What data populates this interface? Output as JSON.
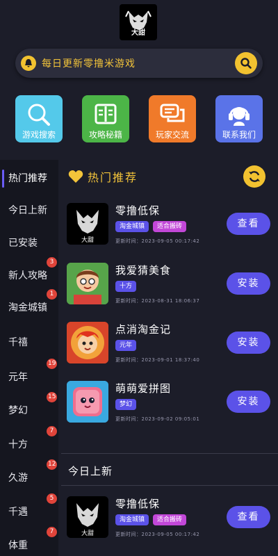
{
  "logo": {
    "text": "大甜"
  },
  "search": {
    "placeholder": "每日更新零撸米游戏",
    "icon": "search-icon",
    "accent": "#f2c230"
  },
  "quick_actions": [
    {
      "label": "游戏搜索",
      "icon": "magnifier-icon",
      "color": "#54c9ea"
    },
    {
      "label": "攻略秘籍",
      "icon": "book-icon",
      "color": "#4cb547"
    },
    {
      "label": "玩家交流",
      "icon": "chat-icon",
      "color": "#f07a2a"
    },
    {
      "label": "联系我们",
      "icon": "headset-icon",
      "color": "#5a73e8"
    }
  ],
  "sidebar": {
    "items": [
      {
        "label": "热门推荐",
        "badge": ""
      },
      {
        "label": "今日上新",
        "badge": ""
      },
      {
        "label": "已安装",
        "badge": ""
      },
      {
        "label": "新人攻略",
        "badge": "3"
      },
      {
        "label": "淘金城镇",
        "badge": "1"
      },
      {
        "label": "千禧",
        "badge": ""
      },
      {
        "label": "元年",
        "badge": "19"
      },
      {
        "label": "梦幻",
        "badge": "15"
      },
      {
        "label": "十方",
        "badge": "7"
      },
      {
        "label": "久游",
        "badge": "12"
      },
      {
        "label": "千遇",
        "badge": "5"
      },
      {
        "label": "体重",
        "badge": "7"
      }
    ]
  },
  "hot": {
    "title": "热门推荐",
    "games": [
      {
        "name": "零撸低保",
        "tags": [
          "淘金城镇",
          "适合搬砖"
        ],
        "time": "更新时间：2023-09-05 00:17:42",
        "button": "查看"
      },
      {
        "name": "我爱猜美食",
        "tags": [
          "十方"
        ],
        "time": "更新时间：2023-08-31 18:06:37",
        "button": "安装"
      },
      {
        "name": "点消淘金记",
        "tags": [
          "元年"
        ],
        "time": "更新时间：2023-09-01 18:37:40",
        "button": "安装"
      },
      {
        "name": "萌萌爱拼图",
        "tags": [
          "梦幻"
        ],
        "time": "更新时间：2023-09-02 09:05:01",
        "button": "安装"
      }
    ]
  },
  "new": {
    "title": "今日上新",
    "games": [
      {
        "name": "零撸低保",
        "tags": [
          "淘金城镇",
          "适合搬砖"
        ],
        "time": "更新时间：2023-09-05 00:17:42",
        "button": "查看"
      }
    ]
  }
}
